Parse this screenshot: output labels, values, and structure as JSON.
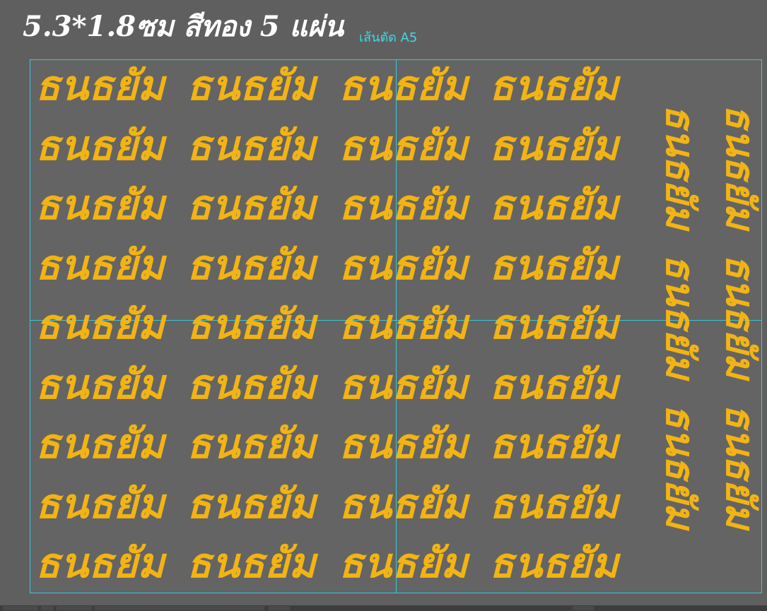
{
  "header": {
    "title": "5.3*1.8ซม สีทอง 5 แผ่น",
    "cut_label": "เส้นตัด A5"
  },
  "sticker": {
    "text": "ธนธยัม",
    "color": "#f2b414",
    "horizontal_rows": 9,
    "horizontal_cols": 4,
    "vertical_columns": 2,
    "vertical_per_column": 3
  },
  "colors": {
    "background": "#5f5f5f",
    "guide": "#36c9d8",
    "title": "#ffffff"
  }
}
